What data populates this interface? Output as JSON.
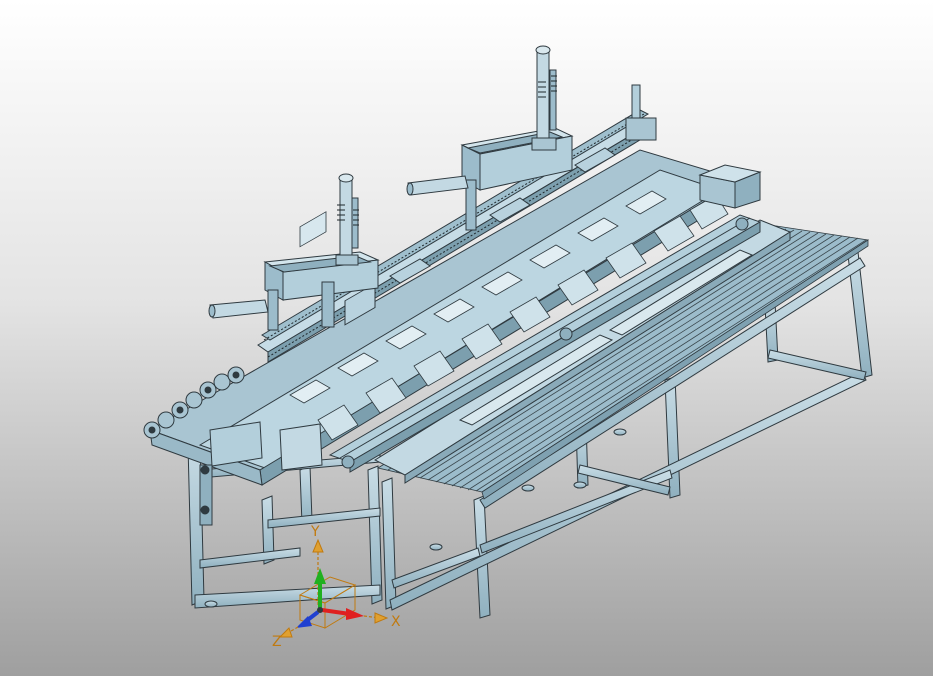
{
  "viewport": {
    "background_top": "#ffffff",
    "background_bottom": "#9f9f9f",
    "model_fill": "#b6d0db",
    "model_stroke": "#2f3a40"
  },
  "triad": {
    "x_label": "X",
    "y_label": "Y",
    "z_label": "Z",
    "x_color": "#e02020",
    "y_color": "#20b020",
    "z_color": "#2040d0",
    "label_color": "#c07a10"
  }
}
